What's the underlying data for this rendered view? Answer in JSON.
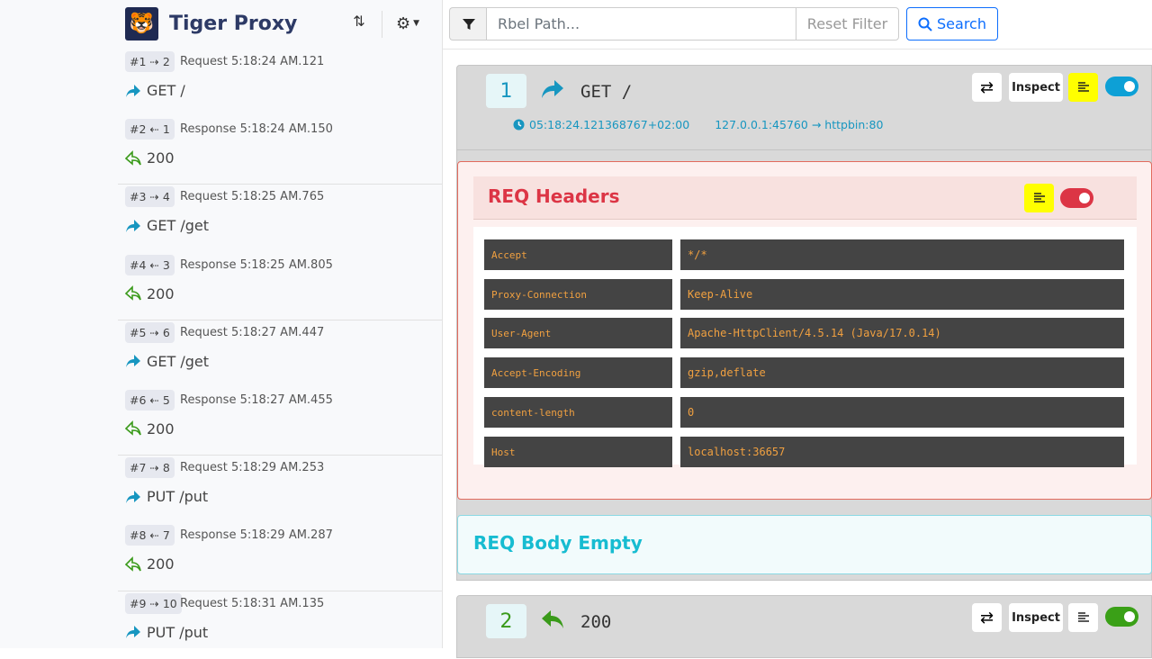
{
  "app": {
    "title": "Tiger Proxy"
  },
  "search": {
    "placeholder": "Rbel Path...",
    "reset_label": "Reset Filter",
    "search_label": "Search"
  },
  "messages": [
    {
      "seq": "#1 ⇢ 2",
      "info": "Request 5:18:24 AM.121",
      "text": "GET /",
      "kind": "request"
    },
    {
      "seq": "#2 ⇠ 1",
      "info": "Response 5:18:24 AM.150",
      "text": "200",
      "kind": "response"
    },
    {
      "seq": "#3 ⇢ 4",
      "info": "Request 5:18:25 AM.765",
      "text": "GET /get",
      "kind": "request"
    },
    {
      "seq": "#4 ⇠ 3",
      "info": "Response 5:18:25 AM.805",
      "text": "200",
      "kind": "response"
    },
    {
      "seq": "#5 ⇢ 6",
      "info": "Request 5:18:27 AM.447",
      "text": "GET /get",
      "kind": "request"
    },
    {
      "seq": "#6 ⇠ 5",
      "info": "Response 5:18:27 AM.455",
      "text": "200",
      "kind": "response"
    },
    {
      "seq": "#7 ⇢ 8",
      "info": "Request 5:18:29 AM.253",
      "text": "PUT /put",
      "kind": "request"
    },
    {
      "seq": "#8 ⇠ 7",
      "info": "Response 5:18:29 AM.287",
      "text": "200",
      "kind": "response"
    },
    {
      "seq": "#9 ⇢ 10",
      "info": "Request 5:18:31 AM.135",
      "text": "PUT /put",
      "kind": "request"
    }
  ],
  "card1": {
    "number": "1",
    "title": "GET /",
    "timestamp": "05:18:24.121368767+02:00",
    "source": "127.0.0.1:45760",
    "target": "httpbin:80",
    "inspect_label": "Inspect",
    "headers_title": "REQ Headers",
    "headers": [
      {
        "key": "Accept",
        "value": "*/*"
      },
      {
        "key": "Proxy-Connection",
        "value": "Keep-Alive"
      },
      {
        "key": "User-Agent",
        "value": "Apache-HttpClient/4.5.14 (Java/17.0.14)"
      },
      {
        "key": "Accept-Encoding",
        "value": "gzip,deflate"
      },
      {
        "key": "content-length",
        "value": "0"
      },
      {
        "key": "Host",
        "value": "localhost:36657"
      }
    ],
    "body_title": "REQ Body Empty"
  },
  "card2": {
    "number": "2",
    "title": "200",
    "inspect_label": "Inspect"
  },
  "colors": {
    "request": "#1796c0",
    "response": "#3a9a1a",
    "headers": "#dc3545",
    "body": "#17bcd1"
  },
  "icons": {
    "request": "share-arrow-icon",
    "response": "reply-arrow-icon",
    "filter": "funnel-icon",
    "search": "magnifier-icon",
    "settings": "gear-icon",
    "sort": "sort-icon"
  }
}
